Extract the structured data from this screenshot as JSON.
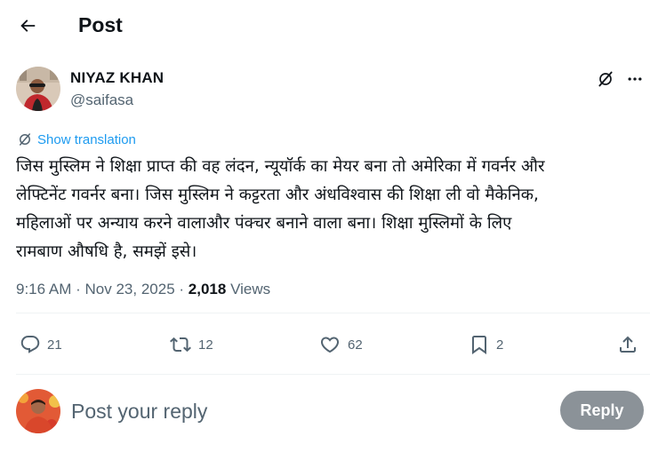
{
  "header": {
    "title": "Post",
    "back_icon": "arrow-left-icon"
  },
  "author": {
    "name": "NIYAZ KHAN",
    "handle": "@saifasa"
  },
  "tweet": {
    "translate_label": "Show translation",
    "lines": [
      "जिस मुस्लिम ने शिक्षा प्राप्त की वह लंदन, न्यूयॉर्क का मेयर बना तो अमेरिका में गवर्नर और",
      "लेफ्टिनेंट गवर्नर बना। जिस मुस्लिम ने कट्टरता और अंधविश्वास की शिक्षा ली वो मैकेनिक,",
      "महिलाओं पर अन्याय करने वालाऔर पंक्चर बनाने वाला बना। शिक्षा मुस्लिमों के लिए",
      "रामबाण औषधि है, समझें इसे।"
    ]
  },
  "meta": {
    "time": "9:16 AM",
    "separator": "·",
    "date": "Nov 23, 2025",
    "views_count": "2,018",
    "views_label": "Views"
  },
  "actions": {
    "replies": "21",
    "reposts": "12",
    "likes": "62",
    "bookmarks": "2"
  },
  "reply_box": {
    "placeholder": "Post your reply",
    "button": "Reply"
  },
  "colors": {
    "accent": "#1d9bf0",
    "text": "#0f1419",
    "secondary": "#536471",
    "reply_button_disabled": "#8b9298"
  }
}
